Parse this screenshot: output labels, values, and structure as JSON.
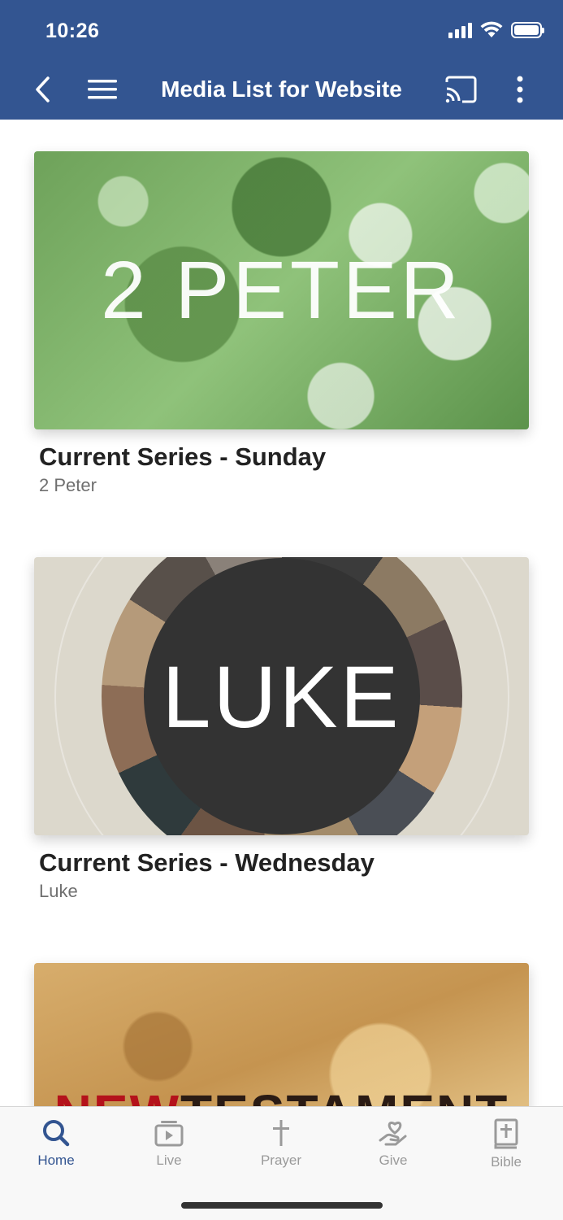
{
  "status_bar": {
    "time": "10:26"
  },
  "header": {
    "title": "Media List for Website"
  },
  "cards": [
    {
      "image_text": "2 PETER",
      "title": "Current Series - Sunday",
      "subtitle": "2 Peter"
    },
    {
      "image_text": "LUKE",
      "title": "Current Series - Wednesday",
      "subtitle": "Luke"
    },
    {
      "image_text_red": "NEW",
      "image_text_dark": "TESTAMENT"
    }
  ],
  "tabs": [
    {
      "label": "Home",
      "icon": "search-icon",
      "active": true
    },
    {
      "label": "Live",
      "icon": "play-icon",
      "active": false
    },
    {
      "label": "Prayer",
      "icon": "cross-icon",
      "active": false
    },
    {
      "label": "Give",
      "icon": "give-heart-hand-icon",
      "active": false
    },
    {
      "label": "Bible",
      "icon": "bible-icon",
      "active": false
    }
  ],
  "colors": {
    "brand": "#335591",
    "tab_active": "#335591",
    "tab_inactive": "#9a9a9a"
  }
}
